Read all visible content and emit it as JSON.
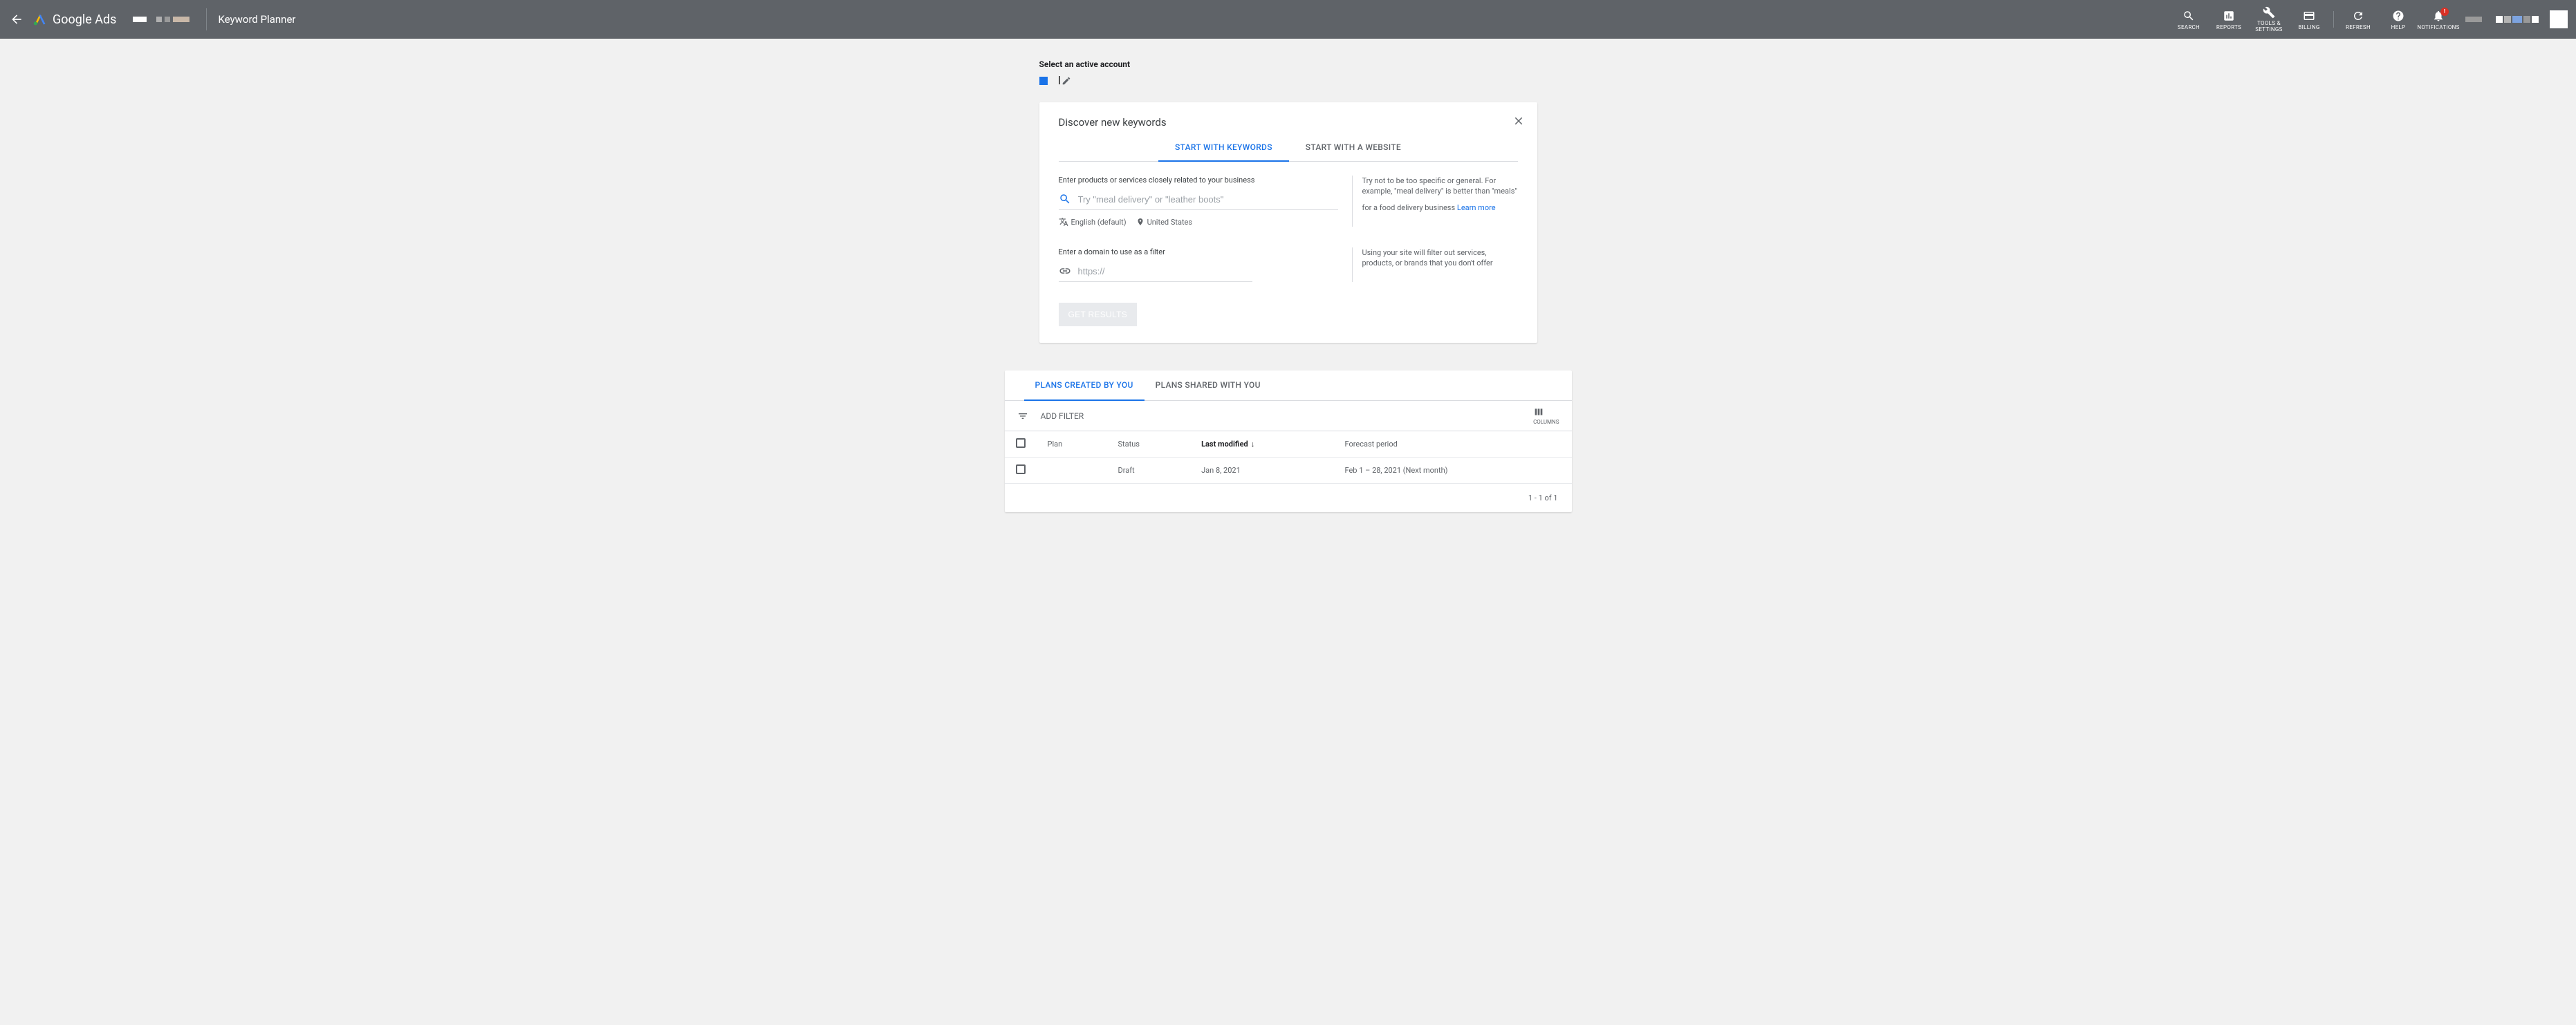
{
  "header": {
    "product": "Google Ads",
    "page_title": "Keyword Planner",
    "actions": {
      "search": "SEARCH",
      "reports": "REPORTS",
      "tools": "TOOLS & SETTINGS",
      "billing": "BILLING",
      "refresh": "REFRESH",
      "help": "HELP",
      "notifications": "NOTIFICATIONS"
    },
    "notification_badge": "!"
  },
  "account_select": {
    "label": "Select an active account"
  },
  "discover": {
    "title": "Discover new keywords",
    "tabs": {
      "keywords": "START WITH KEYWORDS",
      "website": "START WITH A WEBSITE"
    },
    "keywords_section": {
      "label": "Enter products or services closely related to your business",
      "placeholder": "Try \"meal delivery\" or \"leather boots\"",
      "tip": "Try not to be too specific or general. For example, \"meal delivery\" is better than \"meals\" for a food delivery business",
      "language": "English (default)",
      "location": "United States",
      "learn_more": "Learn more"
    },
    "domain_section": {
      "label": "Enter a domain to use as a filter",
      "placeholder": "https://",
      "tip": "Using your site will filter out services, products, or brands that you don't offer"
    },
    "cta": "GET RESULTS"
  },
  "plans": {
    "tabs": {
      "created": "PLANS CREATED BY YOU",
      "shared": "PLANS SHARED WITH YOU"
    },
    "filter": {
      "add": "ADD FILTER",
      "columns": "COLUMNS"
    },
    "columns": {
      "plan": "Plan",
      "status": "Status",
      "last_modified": "Last modified",
      "forecast": "Forecast period"
    },
    "rows": [
      {
        "plan": "",
        "status": "Draft",
        "last_modified": "Jan 8, 2021",
        "forecast": "Feb 1 – 28, 2021 (Next month)"
      }
    ],
    "pagination": "1 - 1 of 1"
  }
}
